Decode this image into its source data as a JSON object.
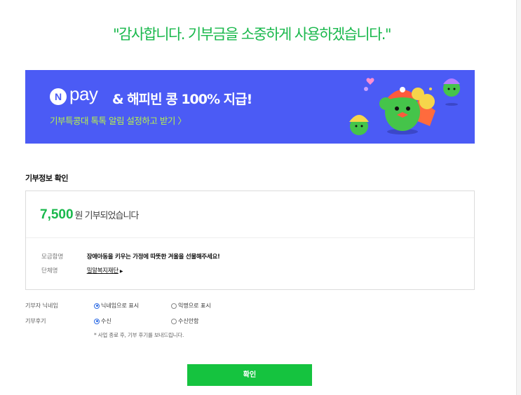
{
  "thanks_message": "\"감사합니다. 기부금을 소중하게 사용하겠습니다.\"",
  "banner": {
    "logo_letter": "N",
    "pay_word": "pay",
    "headline": "& 해피빈 콩 100% 지급!",
    "sub_link": "기부특콩대 톡톡 알림 설정하고 받기 〉",
    "colors": {
      "background": "#4b5bf5",
      "sub_text": "#b8f14a"
    }
  },
  "section_title": "기부정보 확인",
  "donation": {
    "amount": "7,500",
    "amount_suffix": "원 기부되었습니다",
    "fundraiser_label": "모금함명",
    "fundraiser_value": "장애아동을 키우는 가정에 따뜻한 겨울을 선물해주세요!",
    "org_label": "단체명",
    "org_value": "밀알복지재단"
  },
  "options": {
    "nickname": {
      "label": "기부자 닉네임",
      "choices": [
        {
          "text": "닉네임으로 표시",
          "selected": true
        },
        {
          "text": "익명으로 표시",
          "selected": false
        }
      ]
    },
    "review": {
      "label": "기부후기",
      "choices": [
        {
          "text": "수신",
          "selected": true
        },
        {
          "text": "수신안함",
          "selected": false
        }
      ]
    },
    "note": "* 사업 종료 후, 기부 후기를 보내드립니다."
  },
  "confirm_label": "확인",
  "accent_color": "#19b84c"
}
